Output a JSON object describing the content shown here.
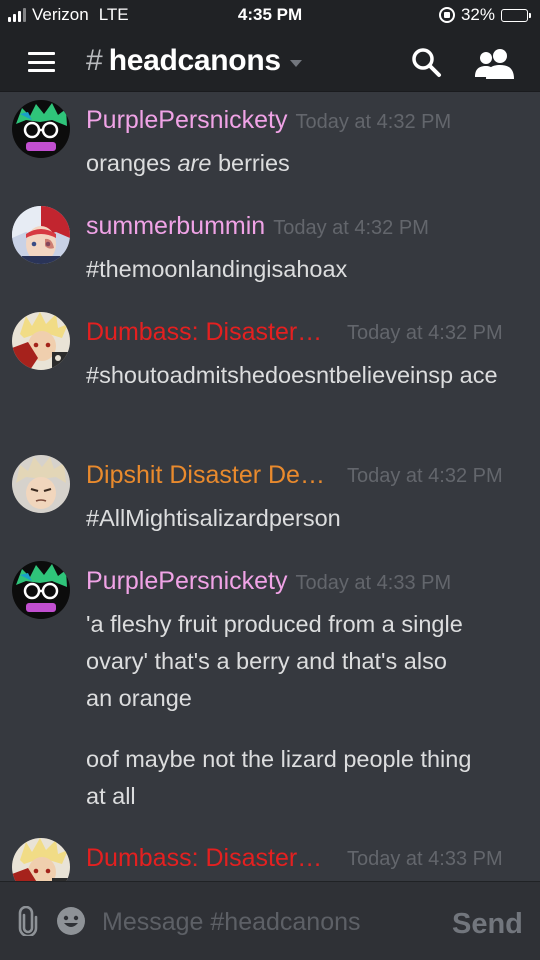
{
  "status_bar": {
    "carrier": "Verizon",
    "network": "LTE",
    "time": "4:35 PM",
    "battery": "32%",
    "battery_level": 0.32
  },
  "header": {
    "hash": "#",
    "channel_name": "headcanons"
  },
  "icons": {
    "menu": "hamburger-menu-icon",
    "search": "search-icon",
    "members": "members-icon",
    "attach": "paperclip-icon",
    "emoji": "emoji-icon"
  },
  "messages": [
    {
      "author": "PurplePersnickety",
      "author_color": "#f0a3e6",
      "timestamp": "Today at 4:32 PM",
      "lines": {
        "before": "oranges ",
        "em": "are",
        "after": " berries"
      }
    },
    {
      "author": "summerbummin",
      "author_color": "#f0a3e6",
      "timestamp": "Today at 4:32 PM",
      "text": "#themoonlandingisahoax"
    },
    {
      "author": "Dumbass: Disaster…",
      "author_color": "#e42020",
      "timestamp": "Today at 4:32 PM",
      "text": "#shoutoadmitshedoesntbelieveinsp ace"
    },
    {
      "author": "Dipshit Disaster De…",
      "author_color": "#e98a2d",
      "timestamp": "Today at 4:32 PM",
      "text": "#AllMightisalizardperson"
    },
    {
      "author": "PurplePersnickety",
      "author_color": "#f0a3e6",
      "timestamp": "Today at 4:33 PM",
      "text": "'a fleshy fruit produced from a single ovary' that's a berry and that's also an orange",
      "text2": "oof maybe not the lizard people thing at all"
    },
    {
      "author": "Dumbass: Disaster…",
      "author_color": "#e42020",
      "timestamp": "Today at 4:33 PM"
    }
  ],
  "composer": {
    "placeholder": "Message #headcanons",
    "send_label": "Send"
  },
  "colors": {
    "background": "#36393f",
    "header_bg": "#202225",
    "timestamp": "#63666c",
    "message_text": "#dcddde"
  }
}
